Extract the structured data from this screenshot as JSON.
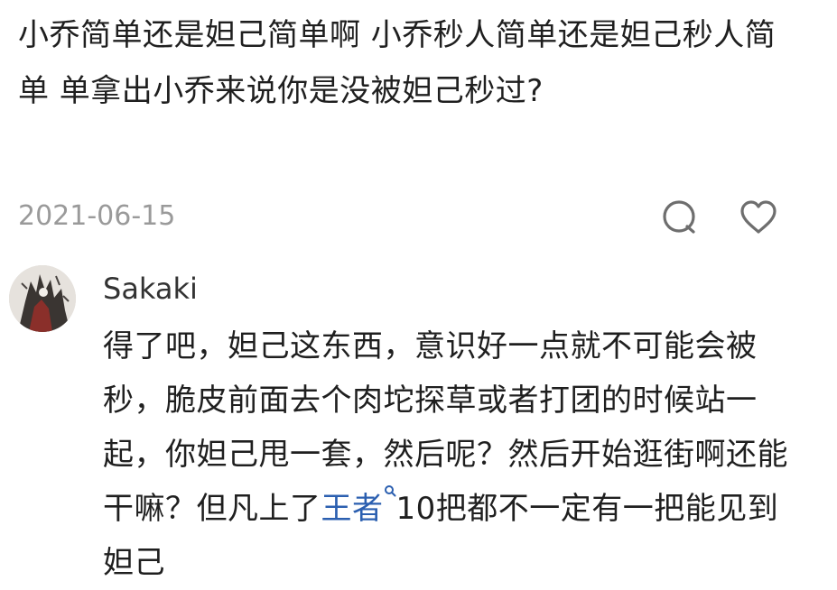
{
  "parent_comment": {
    "text": "小乔简单还是妲己简单啊 小乔秒人简单还是妲己秒人简单 单拿出小乔来说你是没被妲己秒过?",
    "date": "2021-06-15"
  },
  "icons": {
    "reply": "comment-bubble-icon",
    "like": "heart-icon",
    "keyword_search": "search-icon"
  },
  "reply": {
    "username": "Sakaki",
    "text_before_link": "得了吧，妲己这东西，意识好一点就不可能会被秒，脆皮前面去个肉坨探草或者打团的时候站一起，你妲己甩一套，然后呢？然后开始逛街啊还能干嘛？但凡上了",
    "link_text": "王者",
    "text_after_link": "10把都不一定有一把能见到妲己"
  },
  "colors": {
    "text": "#1f1f1f",
    "meta": "#9a9a9a",
    "link": "#2b5fb0"
  }
}
